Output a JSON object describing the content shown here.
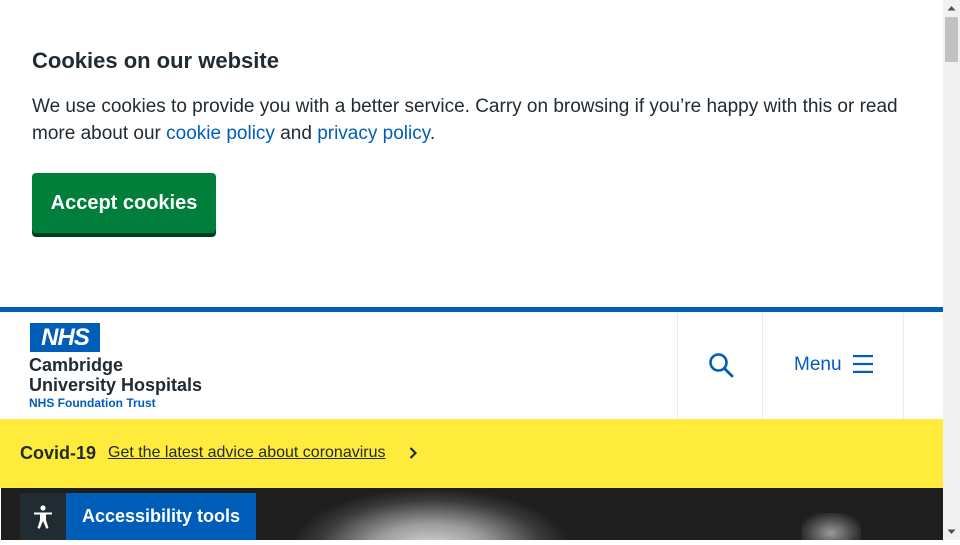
{
  "cookie_banner": {
    "title": "Cookies on our website",
    "text_before": "We use cookies to provide you with a better service. Carry on browsing if you’re happy with this or read more about our ",
    "cookie_policy_link": "cookie policy",
    "text_middle": " and ",
    "privacy_policy_link": "privacy policy",
    "text_after": ".",
    "accept_label": "Accept cookies"
  },
  "header": {
    "logo_text": "NHS",
    "org_name_line1": "Cambridge",
    "org_name_line2": "University Hospitals",
    "org_subtitle": "NHS Foundation Trust",
    "search_icon": "search-icon",
    "menu_label": "Menu",
    "menu_icon": "hamburger-icon"
  },
  "covid_banner": {
    "title": "Covid-19",
    "link_text": "Get the latest advice about coronavirus",
    "chevron_icon": "chevron-right-icon"
  },
  "accessibility": {
    "icon": "accessibility-person-icon",
    "label": "Accessibility tools"
  },
  "colors": {
    "nhs_blue": "#005eb8",
    "accept_green": "#007f3b",
    "covid_yellow": "#ffeb3b",
    "text_dark": "#212b32"
  }
}
